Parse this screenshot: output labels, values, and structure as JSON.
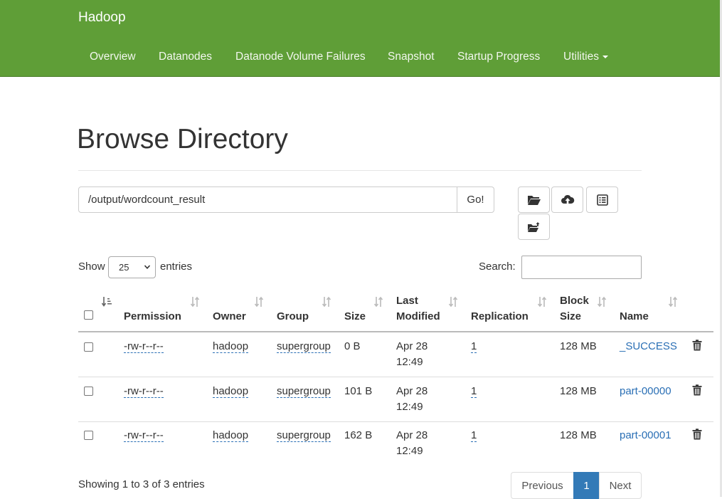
{
  "navbar": {
    "brand": "Hadoop",
    "items": [
      {
        "label": "Overview"
      },
      {
        "label": "Datanodes"
      },
      {
        "label": "Datanode Volume Failures"
      },
      {
        "label": "Snapshot"
      },
      {
        "label": "Startup Progress"
      },
      {
        "label": "Utilities"
      }
    ],
    "color": "#5f9e37"
  },
  "page": {
    "title": "Browse Directory",
    "path_value": "/output/wordcount_result",
    "go_label": "Go!",
    "toolbar_icons": [
      "folder-open-icon",
      "cloud-upload-icon",
      "list-alt-icon",
      "folder-move-icon"
    ]
  },
  "table_controls": {
    "show_label": "Show",
    "entries_label": "entries",
    "page_size": "25",
    "search_label": "Search:",
    "search_value": ""
  },
  "table": {
    "headers": {
      "permission": "Permission",
      "owner": "Owner",
      "group": "Group",
      "size": "Size",
      "last_modified_1": "Last",
      "last_modified_2": "Modified",
      "replication": "Replication",
      "block_size_1": "Block",
      "block_size_2": "Size",
      "name": "Name"
    },
    "rows": [
      {
        "permission": "-rw-r--r--",
        "owner": "hadoop",
        "group": "supergroup",
        "size": "0 B",
        "modified_1": "Apr 28",
        "modified_2": "12:49",
        "replication": "1",
        "block_size": "128 MB",
        "name": "_SUCCESS"
      },
      {
        "permission": "-rw-r--r--",
        "owner": "hadoop",
        "group": "supergroup",
        "size": "101 B",
        "modified_1": "Apr 28",
        "modified_2": "12:49",
        "replication": "1",
        "block_size": "128 MB",
        "name": "part-00000"
      },
      {
        "permission": "-rw-r--r--",
        "owner": "hadoop",
        "group": "supergroup",
        "size": "162 B",
        "modified_1": "Apr 28",
        "modified_2": "12:49",
        "replication": "1",
        "block_size": "128 MB",
        "name": "part-00001"
      }
    ]
  },
  "footer": {
    "info": "Showing 1 to 3 of 3 entries",
    "previous": "Previous",
    "current_page": "1",
    "next": "Next",
    "accent": "#337ab7"
  }
}
